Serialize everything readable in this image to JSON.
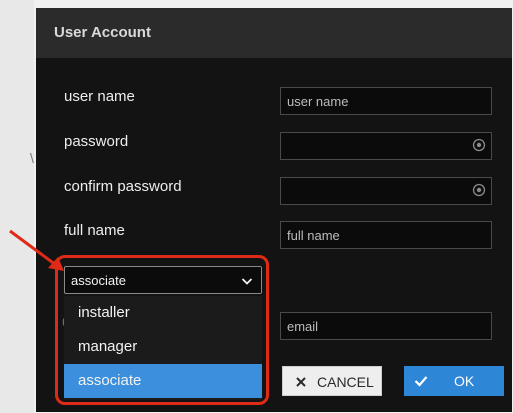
{
  "dialog": {
    "title": "User Account"
  },
  "form": {
    "user_name": {
      "label": "user name",
      "placeholder": "user name"
    },
    "password": {
      "label": "password",
      "placeholder": ""
    },
    "confirm_password": {
      "label": "confirm password",
      "placeholder": ""
    },
    "full_name": {
      "label": "full name",
      "placeholder": "full name"
    },
    "email": {
      "placeholder": "email"
    },
    "role": {
      "selected": "associate",
      "options": [
        "installer",
        "manager",
        "associate"
      ]
    }
  },
  "buttons": {
    "cancel": "CANCEL",
    "ok": "OK"
  },
  "colors": {
    "dialog_bg": "#131313",
    "header_bg": "#2b2b2b",
    "accent": "#3b8fdc",
    "annotation": "#e02a18"
  },
  "icons": {
    "password_toggle": "eye-icon",
    "select": "chevron-down-icon",
    "cancel": "close-icon",
    "ok": "check-icon"
  }
}
